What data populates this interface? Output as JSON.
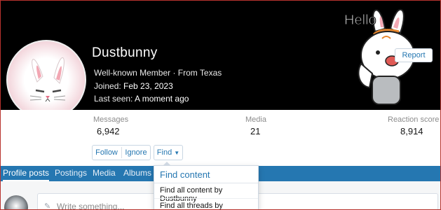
{
  "profile": {
    "username": "Dustbunny",
    "role_line": "Well-known Member · From Texas",
    "joined_label": "Joined:",
    "joined_value": "Feb 23, 2023",
    "last_seen_label": "Last seen:",
    "last_seen_value": "A moment ago",
    "report_label": "Report",
    "sticker_text": "Hello"
  },
  "stats": [
    {
      "label": "Messages",
      "value": "6,942"
    },
    {
      "label": "Media",
      "value": "21"
    },
    {
      "label": "Reaction score",
      "value": "8,914"
    }
  ],
  "actions": {
    "follow": "Follow",
    "ignore": "Ignore",
    "find": "Find"
  },
  "tabs": [
    {
      "label": "Profile posts",
      "active": true
    },
    {
      "label": "Postings",
      "active": false
    },
    {
      "label": "Media",
      "active": false
    },
    {
      "label": "Albums",
      "active": false
    }
  ],
  "find_menu": {
    "title": "Find content",
    "items": [
      "Find all content by Dustbunny",
      "Find all threads by Dustbunny"
    ]
  },
  "post_box": {
    "placeholder": "Write something..."
  },
  "colors": {
    "accent": "#2577b1",
    "banner": "#000000",
    "frame": "#b8332e"
  },
  "icons": {
    "pen": "pen-icon",
    "caret": "caret-down-icon"
  }
}
